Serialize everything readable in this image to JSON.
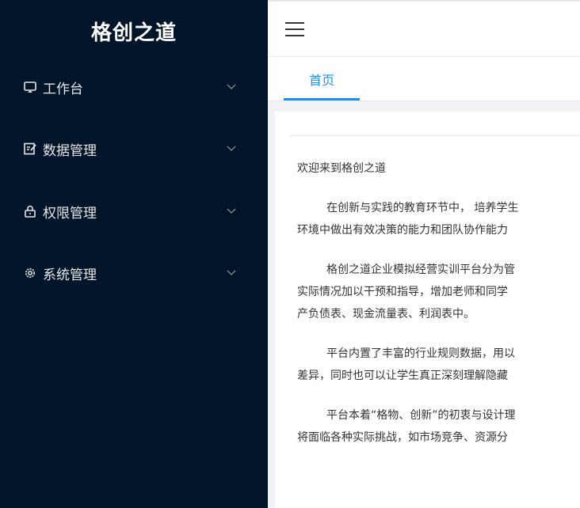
{
  "brand": {
    "title": "格创之道"
  },
  "sidebar": {
    "items": [
      {
        "label": "工作台",
        "icon": "monitor-icon"
      },
      {
        "label": "数据管理",
        "icon": "edit-icon"
      },
      {
        "label": "权限管理",
        "icon": "lock-icon"
      },
      {
        "label": "系统管理",
        "icon": "gear-icon"
      }
    ]
  },
  "tabs": [
    {
      "label": "首页",
      "active": true
    }
  ],
  "content": {
    "welcome": "欢迎来到格创之道",
    "p1": [
      "在创新与实践的教育环节中， 培养学生",
      "环境中做出有效决策的能力和团队协作能力"
    ],
    "p2": [
      "格创之道企业模拟经营实训平台分为管",
      "实际情况加以干预和指导，增加老师和同学",
      "产负债表、现金流量表、利润表中。"
    ],
    "p3": [
      "平台内置了丰富的行业规则数据，用以",
      "差异，同时也可以让学生真正深刻理解隐藏"
    ],
    "p4": [
      "平台本着“格物、创新”的初衷与设计理",
      "将面临各种实际挑战，如市场竞争、资源分"
    ]
  },
  "colors": {
    "sidebar_bg": "#001529",
    "accent": "#1890ff",
    "main_bg": "#f0f2f5"
  }
}
